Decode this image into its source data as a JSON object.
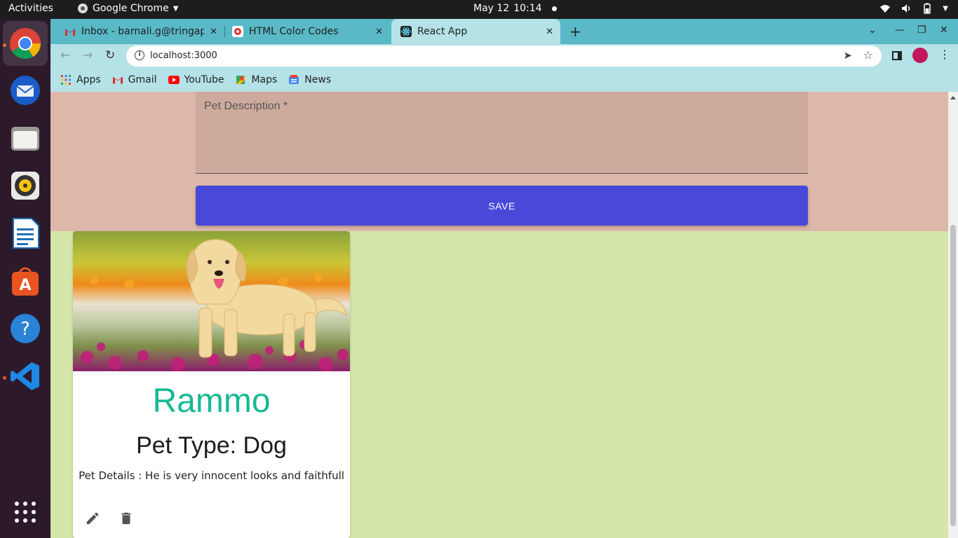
{
  "system_bar": {
    "activities": "Activities",
    "app_name": "Google Chrome",
    "date": "May 12",
    "time": "10:14"
  },
  "dock": {
    "apps": [
      "chrome-icon",
      "thunderbird-icon",
      "files-icon",
      "rhythmbox-icon",
      "writer-icon",
      "software-icon",
      "help-icon",
      "vscode-icon"
    ],
    "grid_icon": "show-apps-icon"
  },
  "browser": {
    "tabs": [
      {
        "title": "Inbox - barnali.g@tringap",
        "icon": "gmail-icon"
      },
      {
        "title": "HTML Color Codes",
        "icon": "htmlcolor-icon"
      },
      {
        "title": "React App",
        "icon": "react-icon",
        "active": true
      }
    ],
    "url": "localhost:3000",
    "bookmarks": [
      {
        "label": "Apps",
        "icon": "apps-grid-icon"
      },
      {
        "label": "Gmail",
        "icon": "gmail-icon"
      },
      {
        "label": "YouTube",
        "icon": "youtube-icon"
      },
      {
        "label": "Maps",
        "icon": "maps-icon"
      },
      {
        "label": "News",
        "icon": "news-icon"
      }
    ]
  },
  "form": {
    "description_label": "Pet Description *",
    "save_label": "SAVE"
  },
  "pet_card": {
    "name": "Rammo",
    "type": "Pet Type: Dog",
    "details": "Pet Details : He is very innocent looks and faithfull",
    "actions": [
      "edit-icon",
      "delete-icon"
    ]
  },
  "colors": {
    "form_background": "#ddb8aa",
    "cards_background": "#d4e6aa",
    "save_button": "#4849d8",
    "pet_name": "#17b994",
    "tab_strip": "#59b9c6",
    "toolbar": "#b5e2e7"
  }
}
